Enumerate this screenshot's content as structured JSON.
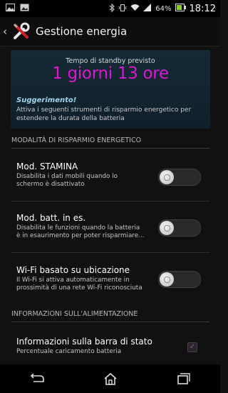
{
  "statusbar": {
    "left_icons": [
      "image-icon",
      "photo-icon"
    ],
    "right_icons": [
      "bluetooth-icon",
      "vibrate-icon",
      "wifi-icon",
      "signal-icon",
      "battery-icon"
    ],
    "battery_percent": "64%",
    "time": "18:12"
  },
  "actionbar": {
    "title": "Gestione energia",
    "icon": "tools-icon"
  },
  "hero": {
    "label": "Tempo di standby previsto",
    "value": "1 giorni 13 ore",
    "tip_title": "Suggerimento!",
    "tip_text": "Attiva i seguenti strumenti di risparmio energetico per estendere la durata della batteria",
    "value_color": "#d81bd0"
  },
  "sections": {
    "power_saving": {
      "header": "MODALITÀ DI RISPARMIO ENERGETICO"
    },
    "power_info": {
      "header": "INFORMAZIONI SULL'ALIMENTAZIONE"
    }
  },
  "settings": [
    {
      "title": "Mod. STAMINA",
      "subtitle": "Disabilita i dati mobili quando lo schermo è disattivato",
      "enabled": false
    },
    {
      "title": "Mod. batt. in es.",
      "subtitle": "Disabilita le funzioni quando la batteria è in esaurimento per poter risparmiare...",
      "enabled": false
    },
    {
      "title": "Wi-Fi basato su ubicazione",
      "subtitle": "Il Wi-Fi si attiva automaticamente in prossimità di una rete Wi-Fi riconosciuta",
      "enabled": false
    }
  ],
  "statusbar_info": {
    "title": "Informazioni sulla barra di stato",
    "subtitle": "Percentuale caricamento batteria",
    "checked": true
  },
  "navbar": {
    "buttons": [
      "back-icon",
      "home-icon",
      "recent-apps-icon"
    ]
  }
}
